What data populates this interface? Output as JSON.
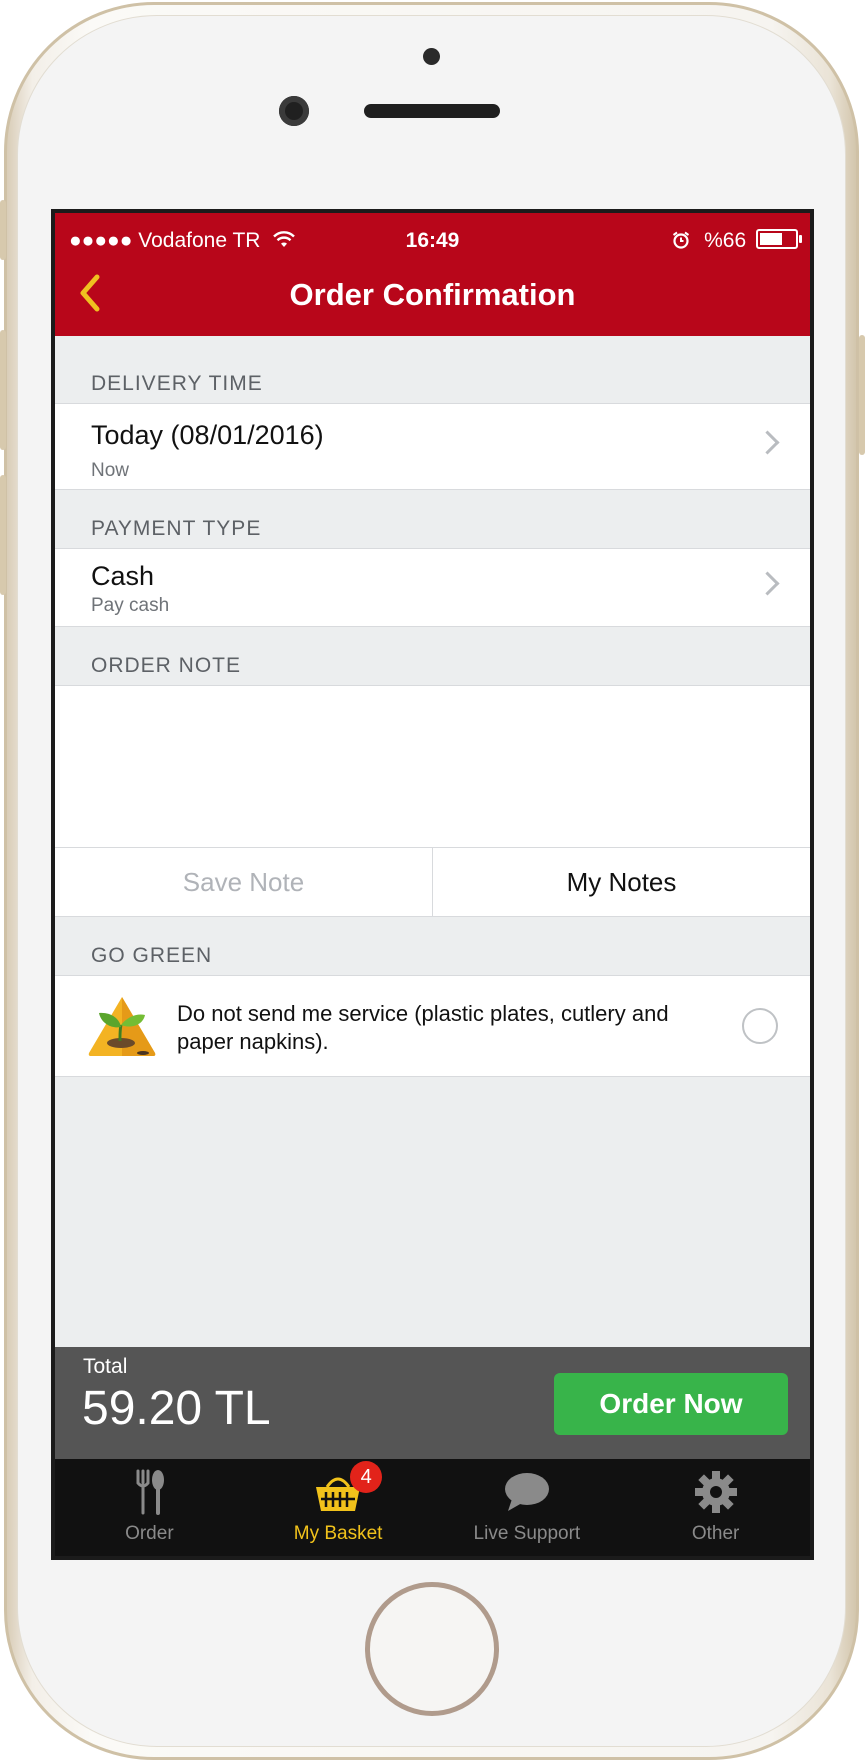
{
  "status_bar": {
    "carrier": "●●●●● Vodafone TR",
    "time": "16:49",
    "battery": "%66"
  },
  "navbar": {
    "title": "Order Confirmation",
    "back_icon": "chevron-left-icon",
    "accent_color": "#b8061a",
    "back_color": "#f0c020"
  },
  "delivery": {
    "header": "DELIVERY TIME",
    "value": "Today (08/01/2016)",
    "detail": "Now"
  },
  "payment": {
    "header": "PAYMENT TYPE",
    "value": "Cash",
    "detail": "Pay cash"
  },
  "order_note": {
    "header": "ORDER NOTE",
    "text": "",
    "save_label": "Save Note",
    "my_notes_label": "My Notes"
  },
  "go_green": {
    "header": "GO GREEN",
    "text": "Do not send me service (plastic plates, cutlery and paper napkins).",
    "checked": false
  },
  "total": {
    "label": "Total",
    "value": "59.20 TL",
    "order_button": "Order Now",
    "button_color": "#38b44a"
  },
  "tabs": [
    {
      "label": "Order",
      "icon": "fork-spoon-icon",
      "active": false
    },
    {
      "label": "My Basket",
      "icon": "basket-icon",
      "active": true,
      "badge": "4"
    },
    {
      "label": "Live Support",
      "icon": "chat-bubble-icon",
      "active": false
    },
    {
      "label": "Other",
      "icon": "gear-icon",
      "active": false
    }
  ]
}
